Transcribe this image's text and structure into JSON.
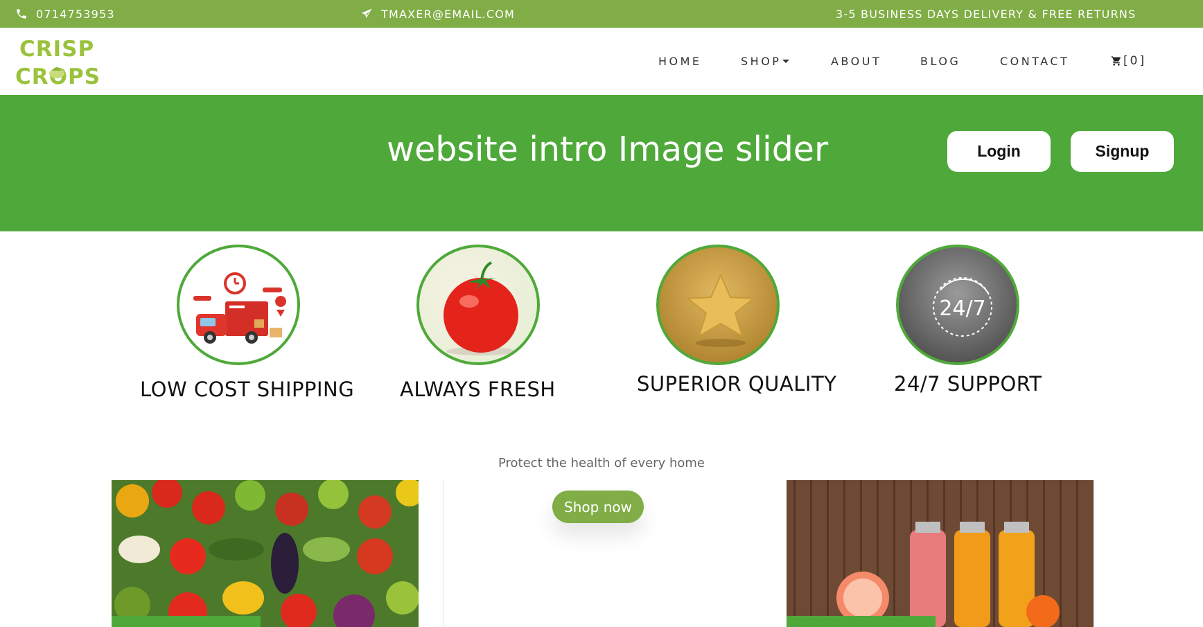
{
  "topbar": {
    "phone": "0714753953",
    "email": "TMAXER@EMAIL.COM",
    "delivery": "3-5 BUSINESS DAYS DELIVERY & FREE RETURNS",
    "phone_icon": "phone-icon",
    "email_icon": "paper-plane-icon"
  },
  "logo": {
    "line1": "CRISP",
    "line2": "CROPS"
  },
  "nav": {
    "items": [
      "HOME",
      "SHOP",
      "ABOUT",
      "BLOG",
      "CONTACT"
    ],
    "cart_count": "[0]",
    "cart_icon": "cart-icon"
  },
  "hero": {
    "title": "website intro Image slider",
    "login": "Login",
    "signup": "Signup"
  },
  "features": [
    {
      "label": "LOW COST SHIPPING",
      "icon": "delivery-truck-image"
    },
    {
      "label": "ALWAYS FRESH",
      "icon": "tomato-image"
    },
    {
      "label": "SUPERIOR QUALITY",
      "icon": "gold-star-image"
    },
    {
      "label": "24/7 SUPPORT",
      "icon": "support-24-7-image",
      "badge": "24/7"
    }
  ],
  "promo": {
    "tagline": "Protect the health of every home",
    "shop_button": "Shop now"
  },
  "colors": {
    "topbar": "#80ad46",
    "hero": "#4fa93a",
    "logo": "#9ac23c",
    "ring": "#4fa93a"
  }
}
